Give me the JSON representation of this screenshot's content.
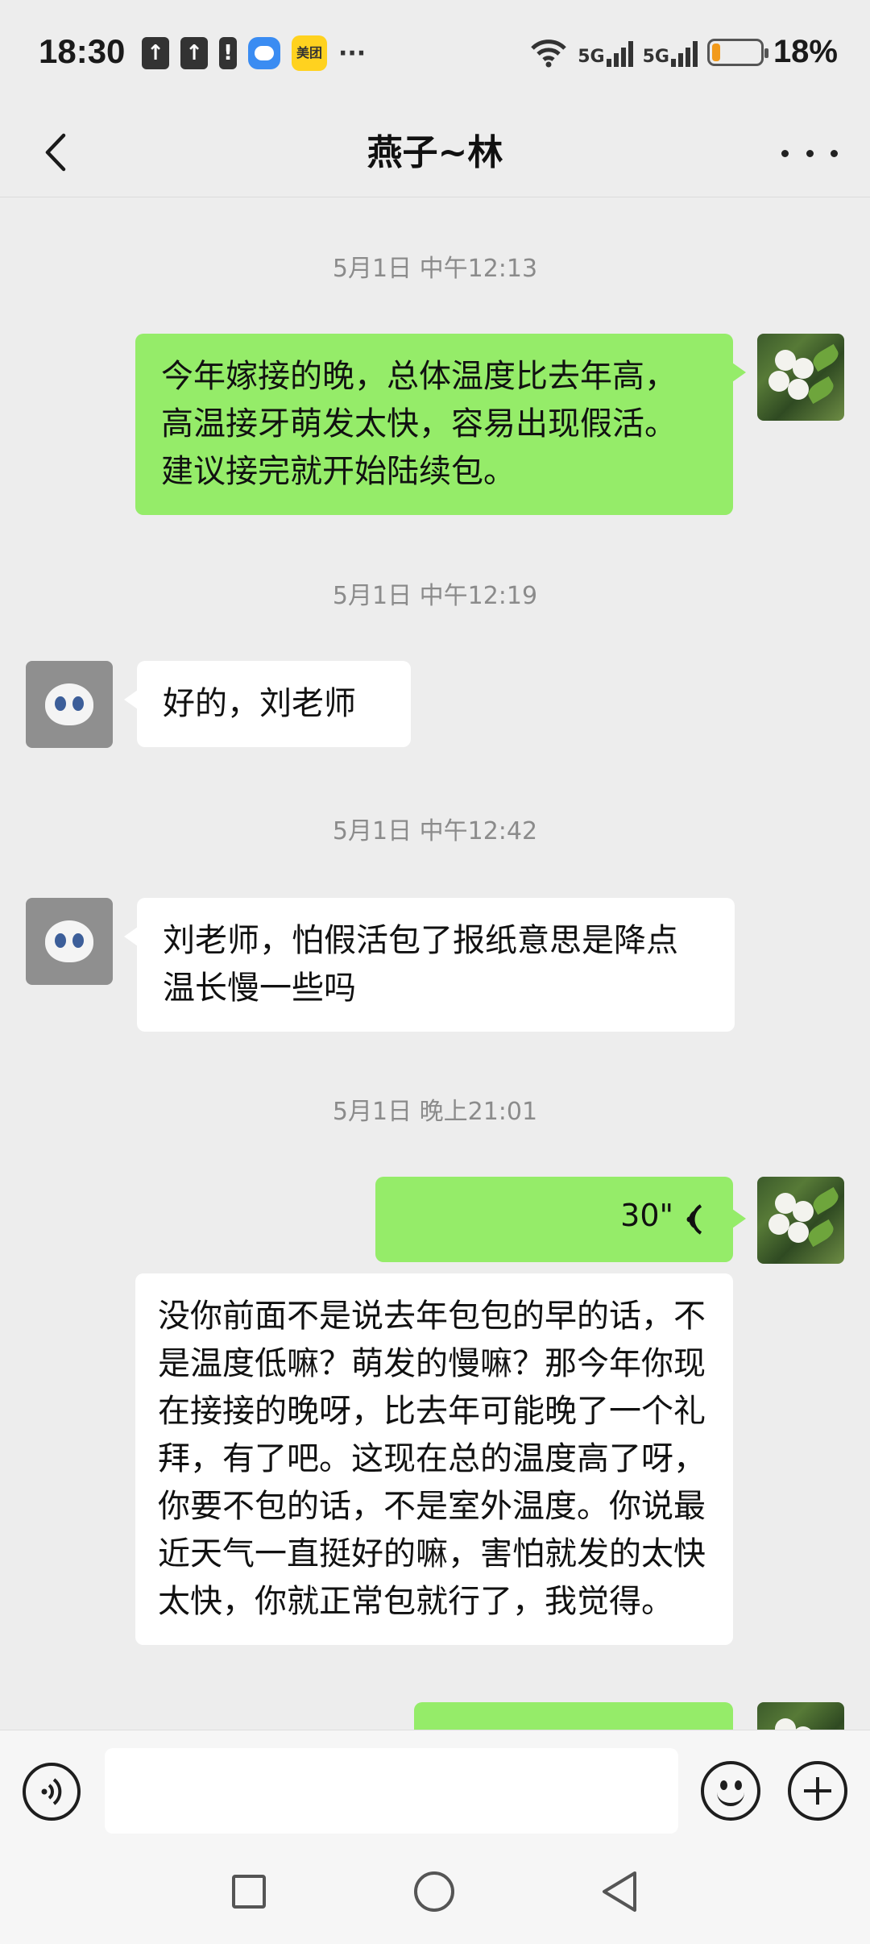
{
  "status_bar": {
    "time": "18:30",
    "notif_icons": [
      "upload-icon",
      "upload-icon",
      "alert-icon",
      "message-icon",
      "meituan-icon",
      "more-notifications-icon"
    ],
    "meituan_label": "美团",
    "more": "···",
    "network": [
      "wifi-icon",
      "5G",
      "5G"
    ],
    "signal_label_1": "5G",
    "signal_label_2": "5G",
    "battery_level": 0.18,
    "battery_color": "#f29a1b",
    "battery_pct": "18%"
  },
  "nav": {
    "title": "燕子~林"
  },
  "messages": [
    {
      "type": "timestamp",
      "text": "5月1日 中午12:13"
    },
    {
      "type": "text",
      "side": "right",
      "avatar": "flower",
      "text": "今年嫁接的晚，总体温度比去年高，高温接牙萌发太快，容易出现假活。建议接完就开始陆续包。"
    },
    {
      "type": "timestamp",
      "text": "5月1日 中午12:19"
    },
    {
      "type": "text",
      "side": "left",
      "avatar": "snow-leopard",
      "text": "好的，刘老师"
    },
    {
      "type": "timestamp",
      "text": "5月1日 中午12:42"
    },
    {
      "type": "text",
      "side": "left",
      "avatar": "snow-leopard",
      "text": "刘老师，怕假活包了报纸意思是降点温长慢一些吗"
    },
    {
      "type": "timestamp",
      "text": "5月1日 晚上21:01"
    },
    {
      "type": "voice",
      "side": "right",
      "avatar": "flower",
      "duration": "30\""
    },
    {
      "type": "transcript",
      "side": "right",
      "text": "没你前面不是说去年包包的早的话，不是温度低嘛？萌发的慢嘛？那今年你现在接接的晚呀，比去年可能晚了一个礼拜，有了吧。这现在总的温度高了呀，你要不包的话，不是室外温度。你说最近天气一直挺好的嘛，害怕就发的太快太快，你就正常包就行了，我觉得。"
    },
    {
      "type": "voice",
      "side": "right",
      "avatar": "flower",
      "duration": ""
    }
  ],
  "input": {
    "value": "",
    "placeholder": ""
  },
  "colors": {
    "background": "#ededed",
    "sent_bubble": "#95ec69",
    "received_bubble": "#ffffff",
    "timestamp": "#8b8b8b"
  }
}
